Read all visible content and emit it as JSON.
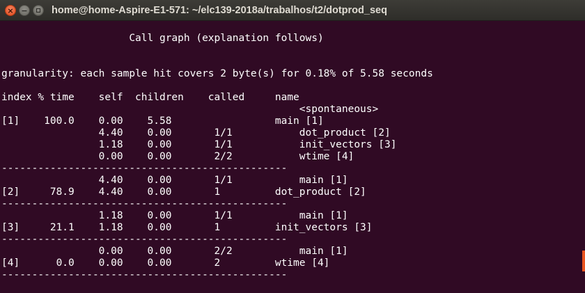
{
  "window": {
    "title": "home@home-Aspire-E1-571: ~/elc139-2018a/trabalhos/t2/dotprod_seq",
    "close_glyph": "×",
    "minimize_glyph": "−"
  },
  "terminal": {
    "lines": [
      "",
      "                     Call graph (explanation follows)",
      "",
      "",
      "granularity: each sample hit covers 2 byte(s) for 0.18% of 5.58 seconds",
      "",
      "index % time    self  children    called     name",
      "                                                 <spontaneous>",
      "[1]    100.0    0.00    5.58                 main [1]",
      "                4.40    0.00       1/1           dot_product [2]",
      "                1.18    0.00       1/1           init_vectors [3]",
      "                0.00    0.00       2/2           wtime [4]",
      "-----------------------------------------------",
      "                4.40    0.00       1/1           main [1]",
      "[2]     78.9    4.40    0.00       1         dot_product [2]",
      "-----------------------------------------------",
      "                1.18    0.00       1/1           main [1]",
      "[3]     21.1    1.18    0.00       1         init_vectors [3]",
      "-----------------------------------------------",
      "                0.00    0.00       2/2           main [1]",
      "[4]      0.0    0.00    0.00       2         wtime [4]",
      "-----------------------------------------------"
    ]
  }
}
